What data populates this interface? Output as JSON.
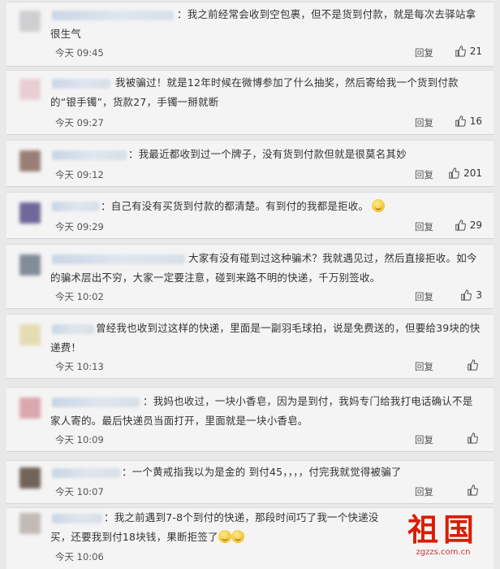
{
  "colors": {
    "page_bg": "#e9e9e9",
    "card_bg": "#f4f4f4",
    "text": "#333333",
    "meta": "#555555",
    "watermark": "#d81e06"
  },
  "icons": {
    "like": "thumbs-up-icon",
    "emoji": "smiley-icon"
  },
  "reply_label": "回复",
  "comments": [
    {
      "text": "：我之前经常会收到空包裹，但不是货到付款，就是每次去驿站拿很生气",
      "time": "今天 09:45",
      "likes": "21"
    },
    {
      "text": "我被骗过！就是12年时候在微博参加了什么抽奖，然后寄给我一个货到付款的“银手镯”，货款27，手镯一掰就断",
      "time": "今天 09:27",
      "likes": "16"
    },
    {
      "text": "：我最近都收到过一个牌子，没有货到付款但就是很莫名其妙",
      "time": "今天 09:12",
      "likes": "201"
    },
    {
      "text": "：自己有没有买货到付款的都清楚。有到付的我都是拒收。",
      "time": "今天 09:29",
      "likes": "29"
    },
    {
      "text": "大家有没有碰到过这种骗术？我就遇见过，然后直接拒收。如今的骗术层出不穷，大家一定要注意，碰到来路不明的快递，千万别签收。",
      "time": "今天 10:02",
      "likes": "3"
    },
    {
      "text": "曾经我也收到过这样的快递，里面是一副羽毛球拍，说是免费送的，但要给39块的快递费！",
      "time": "今天 10:13",
      "likes": ""
    },
    {
      "text": "：我妈也收过，一块小香皂，因为是到付，我妈专门给我打电话确认不是家人寄的。最后快递员当面打开，里面就是一块小香皂。",
      "time": "今天 10:09",
      "likes": ""
    },
    {
      "text": "：一个黄戒指我以为是金的 到付45，，，，付完我就觉得被骗了",
      "time": "今天 10:07",
      "likes": ""
    },
    {
      "text": "：我之前遇到7-8个到付的快递，那段时间巧了我一个快递没买，还要我到付18块钱，果断拒签了",
      "time": "今天 10:06",
      "likes": ""
    }
  ],
  "watermark": {
    "logo_text": "祖国",
    "url": "zgzzs.com.cn"
  }
}
